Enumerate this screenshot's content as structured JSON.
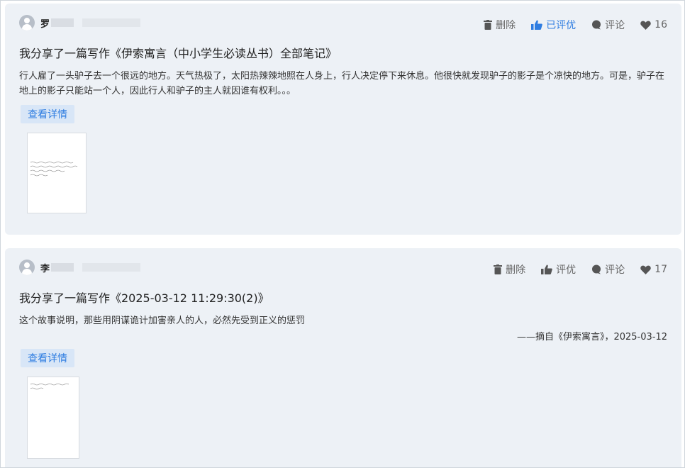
{
  "posts": [
    {
      "author": "罗",
      "actions": {
        "delete": "删除",
        "rate": "已评优",
        "comment": "评论",
        "likes": "16"
      },
      "title": "我分享了一篇写作《伊索寓言（中小学生必读丛书）全部笔记》",
      "excerpt": "行人雇了一头驴子去一个很远的地方。天气热极了，太阳热辣辣地照在人身上，行人决定停下来休息。他很快就发现驴子的影子是个凉快的地方。可是，驴子在地上的影子只能站一个人，因此行人和驴子的主人就因谁有权利。。。",
      "detail": "查看详情",
      "thumb_alt": "handwritten-note"
    },
    {
      "author": "李",
      "actions": {
        "delete": "删除",
        "rate": "评优",
        "comment": "评论",
        "likes": "17"
      },
      "title": "我分享了一篇写作《2025-03-12 11:29:30(2)》",
      "excerpt": "这个故事说明，那些用阴谋诡计加害亲人的人，必然先受到正义的惩罚",
      "source": "——摘自《伊索寓言》，2025-03-12",
      "detail": "查看详情",
      "thumb_alt": "handwritten-note"
    }
  ],
  "colors": {
    "card_bg": "#edf1f6",
    "accent": "#2f7de1",
    "muted": "#666666"
  },
  "icons": [
    "user-avatar-icon",
    "trash-icon",
    "thumbs-up-icon",
    "comment-icon",
    "heart-icon"
  ]
}
